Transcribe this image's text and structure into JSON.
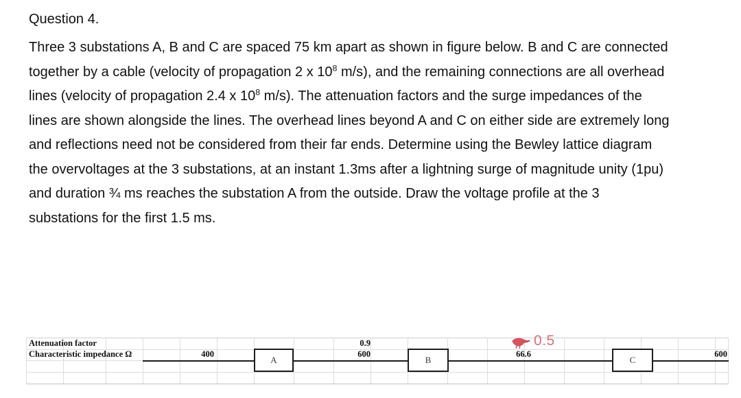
{
  "question": {
    "heading": "Question 4.",
    "body_html": "Three 3 substations A, B and C are spaced 75 km apart as shown in figure below. B and C are connected together by a cable (velocity of propagation 2 x 10<sup>8</sup> m/s), and the remaining connections are all overhead lines (velocity of propagation 2.4 x 10<sup>8</sup> m/s). The attenuation factors and the surge impedances of the lines are shown alongside the lines. The overhead lines beyond A and C on either side are extremely long and reflections need not be considered from their far ends. Determine using the Bewley lattice diagram the overvoltages at the 3 substations, at an instant 1.3ms after a lightning surge of magnitude unity  (1pu) and duration ¾ ms reaches the substation A from the outside. Draw the voltage profile at the 3 substations for the first 1.5 ms.",
    "body_plain": "Three 3 substations A, B and C are spaced 75 km apart as shown in figure below. B and C are connected together by a cable (velocity of propagation 2 x 10^8 m/s), and the remaining connections are all overhead lines (velocity of propagation 2.4 x 10^8 m/s). The attenuation factors and the surge impedances of the lines are shown alongside the lines. The overhead lines beyond A and C on either side are extremely long and reflections need not be considered from their far ends. Determine using the Bewley lattice diagram the overvoltages at the 3 substations, at an instant 1.3ms after a lightning surge of magnitude unity (1pu) and duration 3/4 ms reaches the substation A from the outside. Draw the voltage profile at the 3 substations for the first 1.5 ms."
  },
  "diagram": {
    "row_labels": {
      "attenuation": "Attenuation factor",
      "impedance": "Characteristic impedance Ω"
    },
    "stations": [
      {
        "label": "A"
      },
      {
        "label": "B"
      },
      {
        "label": "C"
      }
    ],
    "values": {
      "segment1_impedance": "400",
      "segment2_attenuation": "0.9",
      "segment2_impedance": "600",
      "segment3_impedance": "66.6",
      "segment4_impedance": "600"
    },
    "annotation": {
      "text": "0.5",
      "color": "#d9707a",
      "mark": "red-scribble-mark"
    },
    "colors": {
      "grid_line": "#d9dde0",
      "transmission_line": "#1a1a1a",
      "station_border": "#1c1c1c",
      "text": "#0d0d0d"
    }
  }
}
